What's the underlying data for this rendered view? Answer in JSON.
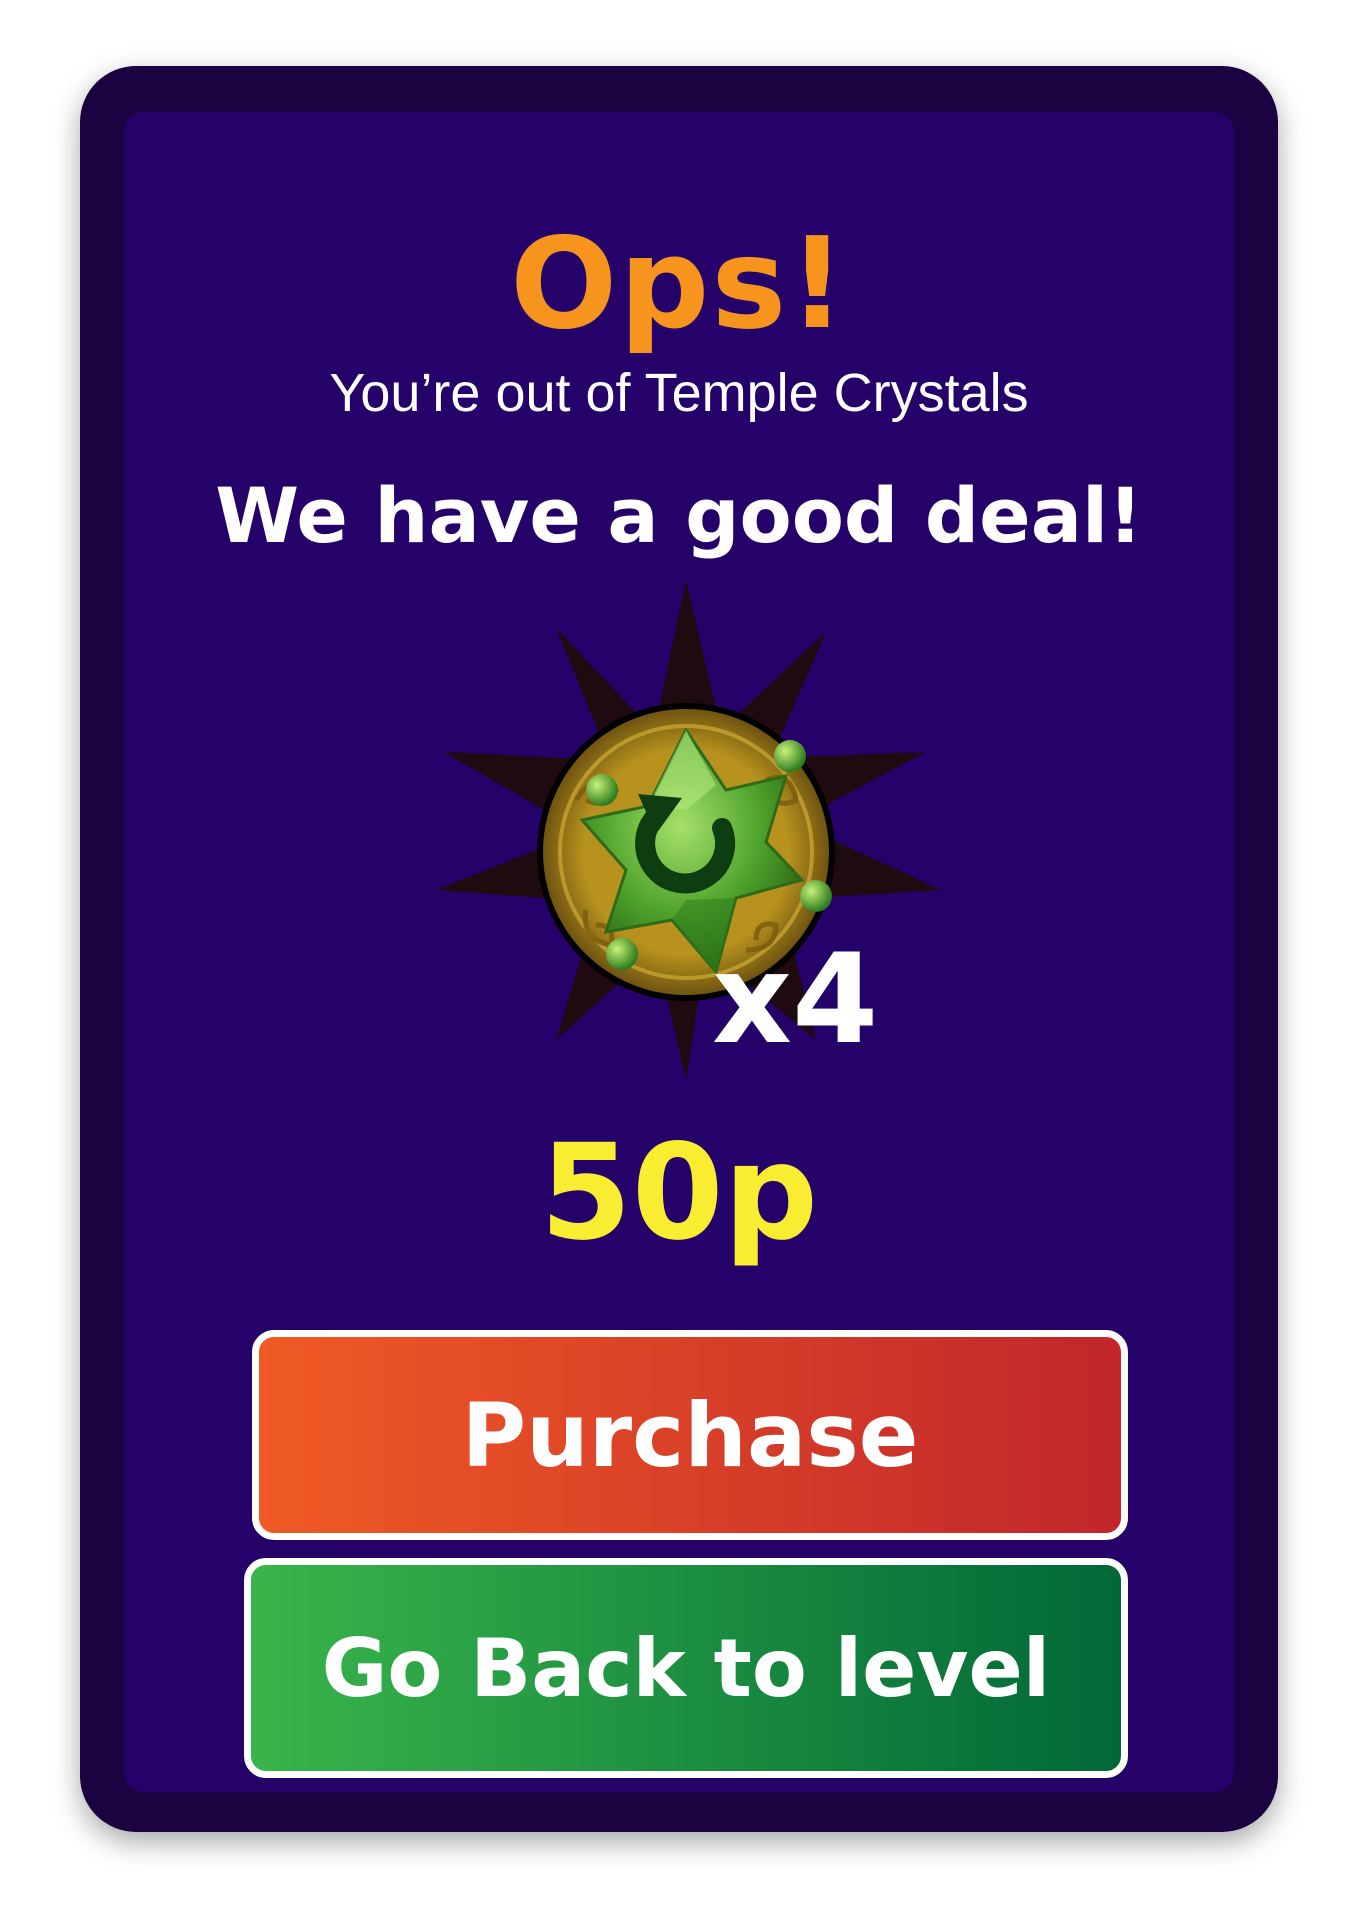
{
  "popup": {
    "title": "Ops!",
    "subtitle": "You’re out of Temple Crystals",
    "deal_text": "We have a good deal!",
    "item": {
      "icon": "temple-crystal-refresh-icon",
      "multiplier": "x4"
    },
    "price": "50p",
    "purchase_button": "Purchase",
    "back_button": "Go Back to level"
  },
  "colors": {
    "title": "#f7941d",
    "price": "#f9ed32",
    "panel": "#25026a",
    "frame": "#1a0340",
    "purchase_start": "#f05a24",
    "purchase_end": "#c1262b",
    "back_start": "#39b54a",
    "back_end": "#006837"
  }
}
